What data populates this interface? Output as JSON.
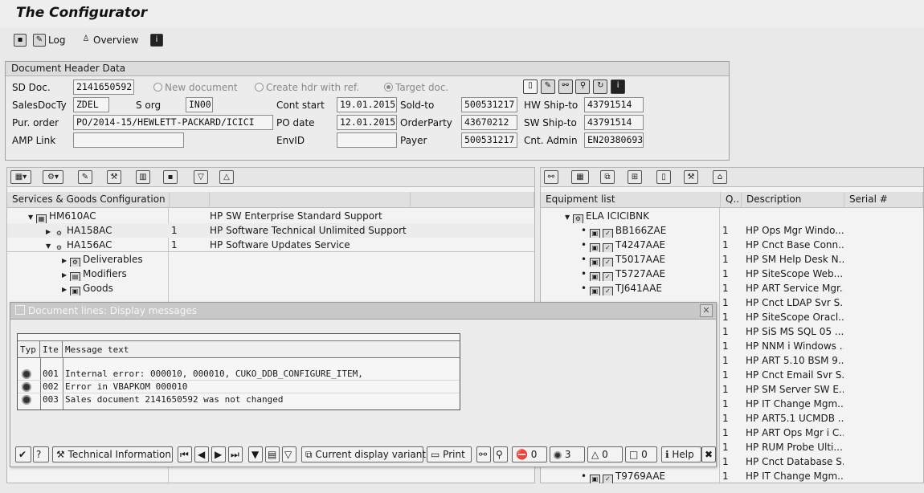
{
  "app": {
    "title": "The Configurator"
  },
  "toolbar": {
    "log_label": "Log",
    "overview_label": "Overview"
  },
  "header": {
    "title": "Document Header Data",
    "sd_doc_label": "SD Doc.",
    "sd_doc_value": "2141650592",
    "radio_new": "New document",
    "radio_create_ref": "Create hdr with ref.",
    "radio_target": "Target doc.",
    "sales_doc_type_label": "SalesDocTy",
    "sales_doc_type_value": "ZDEL",
    "sales_org_label": "S org",
    "sales_org_value": "IN00",
    "cont_start_label": "Cont start",
    "cont_start_value": "19.01.2015",
    "sold_to_label": "Sold-to",
    "sold_to_value": "500531217",
    "hw_ship_to_label": "HW Ship-to",
    "hw_ship_to_value": "43791514",
    "pur_order_label": "Pur. order",
    "pur_order_value": "PO/2014-15/HEWLETT-PACKARD/ICICI",
    "po_date_label": "PO date",
    "po_date_value": "12.01.2015",
    "order_party_label": "OrderParty",
    "order_party_value": "43670212",
    "sw_ship_to_label": "SW Ship-to",
    "sw_ship_to_value": "43791514",
    "amp_link_label": "AMP Link",
    "amp_link_value": "",
    "env_id_label": "EnvID",
    "env_id_value": "",
    "payer_label": "Payer",
    "payer_value": "500531217",
    "cnt_admin_label": "Cnt. Admin",
    "cnt_admin_value": "EN20380693"
  },
  "services": {
    "col_name": "Services & Goods Configuration",
    "rows": [
      {
        "name": "HM610AC",
        "qty": "",
        "desc": "HP SW Enterprise Standard Support"
      },
      {
        "name": "HA158AC",
        "qty": "1",
        "desc": "HP Software Technical Unlimited Support"
      },
      {
        "name": "HA156AC",
        "qty": "1",
        "desc": "HP Software Updates Service"
      },
      {
        "name": "Deliverables",
        "qty": "",
        "desc": ""
      },
      {
        "name": "Modifiers",
        "qty": "",
        "desc": ""
      },
      {
        "name": "Goods",
        "qty": "",
        "desc": ""
      }
    ]
  },
  "equipment": {
    "col_list": "Equipment list",
    "col_qty": "Q..",
    "col_desc": "Description",
    "col_serial": "Serial #",
    "root": "ELA ICICIBNK",
    "rows": [
      {
        "name": "BB166ZAE",
        "qty": "1",
        "desc": "HP Ops Mgr Windo..."
      },
      {
        "name": "T4247AAE",
        "qty": "1",
        "desc": "HP Cnct Base Conn..."
      },
      {
        "name": "T5017AAE",
        "qty": "1",
        "desc": "HP SM Help Desk N..."
      },
      {
        "name": "T5727AAE",
        "qty": "1",
        "desc": "HP SiteScope Web..."
      },
      {
        "name": "TJ641AAE",
        "qty": "1",
        "desc": "HP ART Service Mgr..."
      },
      {
        "name": "",
        "qty": "1",
        "desc": "HP Cnct LDAP Svr S..."
      },
      {
        "name": "",
        "qty": "1",
        "desc": "HP SiteScope Oracl..."
      },
      {
        "name": "",
        "qty": "1",
        "desc": "HP SiS MS SQL 05 ..."
      },
      {
        "name": "",
        "qty": "1",
        "desc": "HP NNM i Windows ..."
      },
      {
        "name": "",
        "qty": "1",
        "desc": "HP ART 5.10 BSM 9..."
      },
      {
        "name": "",
        "qty": "1",
        "desc": "HP Cnct Email Svr S..."
      },
      {
        "name": "",
        "qty": "1",
        "desc": "HP SM Server SW E..."
      },
      {
        "name": "",
        "qty": "1",
        "desc": "HP IT Change Mgm..."
      },
      {
        "name": "",
        "qty": "1",
        "desc": "HP ART5.1 UCMDB ..."
      },
      {
        "name": "",
        "qty": "1",
        "desc": "HP ART Ops Mgr i C..."
      },
      {
        "name": "",
        "qty": "1",
        "desc": "HP RUM Probe Ulti..."
      },
      {
        "name": "",
        "qty": "1",
        "desc": "HP Cnct Database S..."
      },
      {
        "name": "T9769AAE",
        "qty": "1",
        "desc": "HP IT Change Mgm..."
      }
    ]
  },
  "dialog": {
    "title": "Document lines: Display messages",
    "col_typ": "Typ",
    "col_item": "Ite",
    "col_text": "Message text",
    "messages": [
      {
        "item": "001",
        "text": "Internal error: 000010, 000010, CUKO_DDB_CONFIGURE_ITEM,"
      },
      {
        "item": "002",
        "text": "Error in VBAPKOM 000010"
      },
      {
        "item": "003",
        "text": "Sales document 2141650592 was not changed"
      }
    ],
    "tech_info_label": "Technical Information",
    "display_variant_label": "Current display variant",
    "print_label": "Print",
    "count_stop": "0",
    "count_error": "3",
    "count_warning": "0",
    "count_info": "0",
    "help_label": "Help"
  }
}
